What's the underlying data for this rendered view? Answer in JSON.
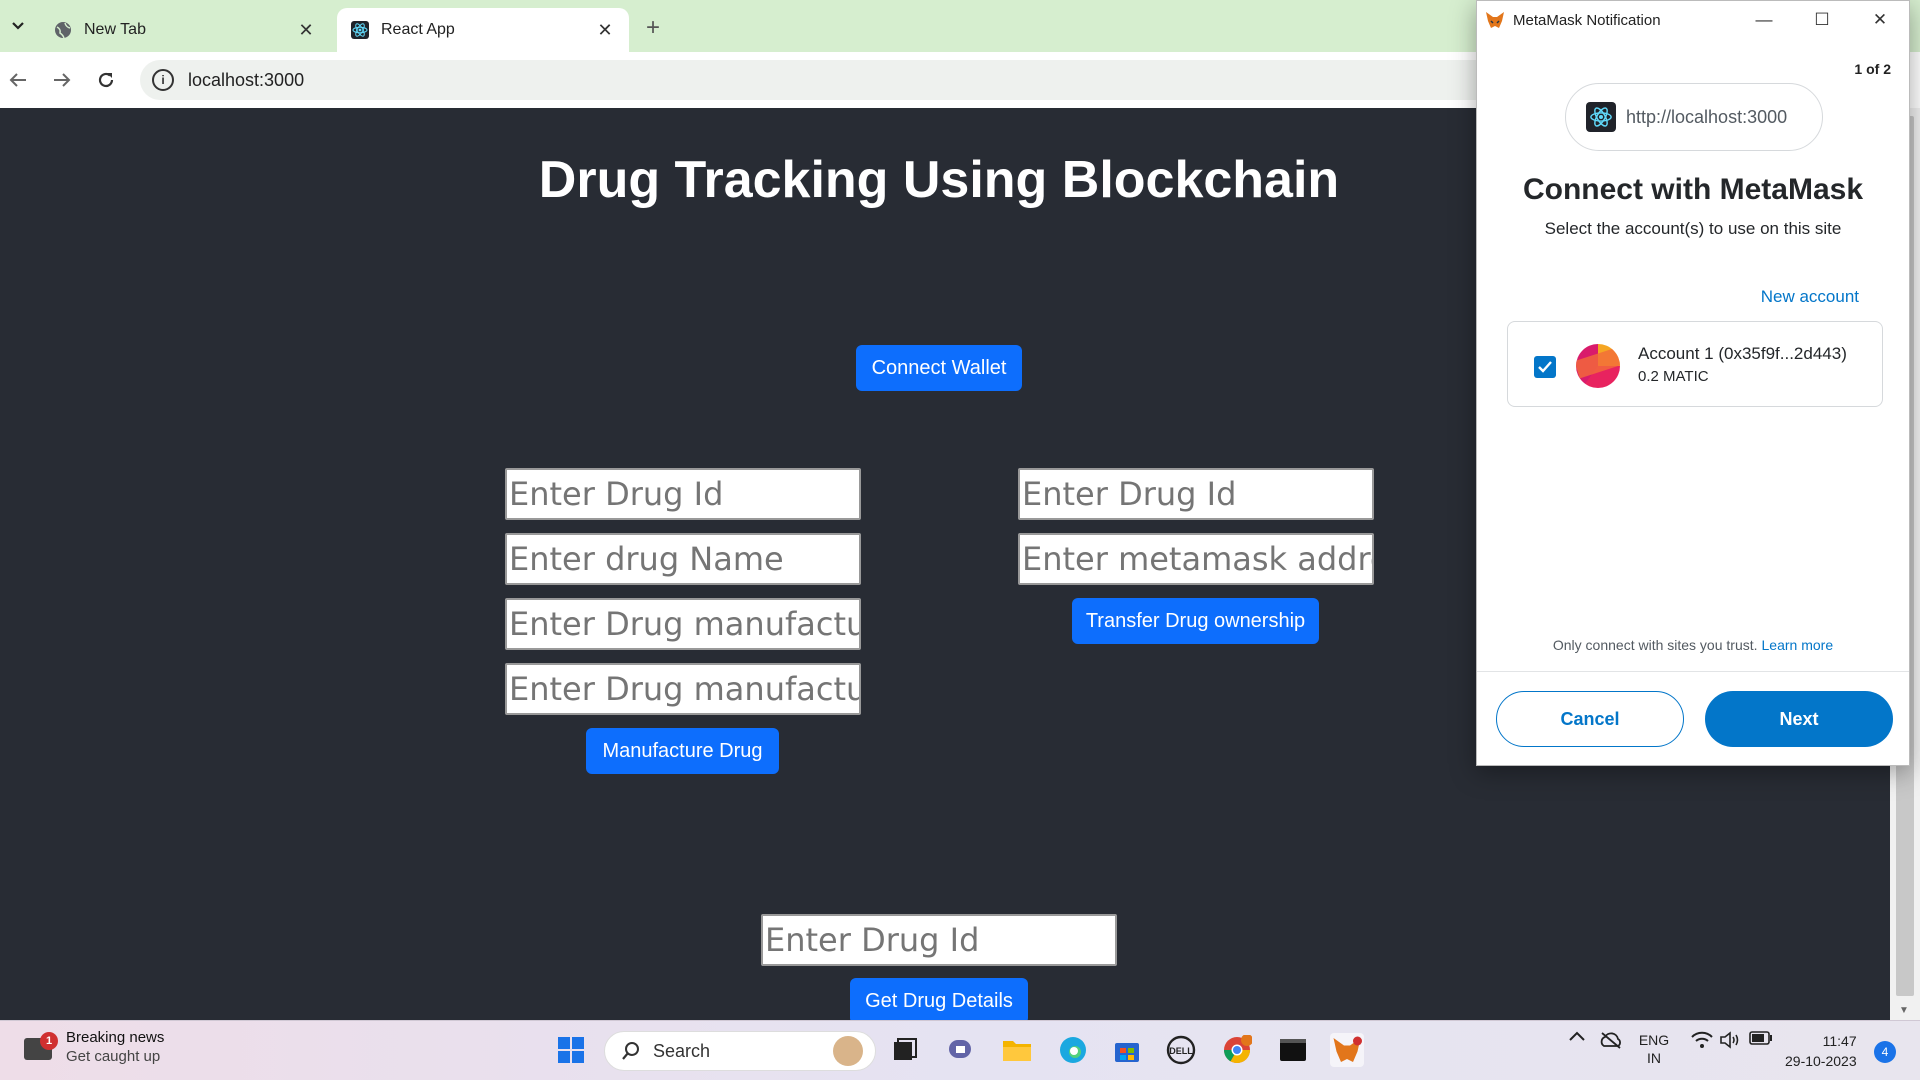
{
  "browser": {
    "tabs": [
      {
        "title": "New Tab",
        "close": "✕"
      },
      {
        "title": "React App",
        "close": "✕"
      }
    ],
    "new_tab": "+",
    "url": "localhost:3000"
  },
  "app": {
    "title": "Drug Tracking Using Blockchain",
    "connect_wallet": "Connect Wallet",
    "manufacture": {
      "fields": [
        "Enter Drug Id",
        "Enter drug Name",
        "Enter Drug manufacturer",
        "Enter Drug manufacturir"
      ],
      "button": "Manufacture Drug"
    },
    "transfer": {
      "fields": [
        "Enter Drug Id",
        "Enter metamask address"
      ],
      "button": "Transfer Drug ownership"
    },
    "details": {
      "field": "Enter Drug Id",
      "button": "Get Drug Details"
    }
  },
  "metamask": {
    "window_title": "MetaMask Notification",
    "pager": "1 of 2",
    "origin": "http://localhost:3000",
    "heading": "Connect with MetaMask",
    "subheading": "Select the account(s) to use on this site",
    "new_account": "New account",
    "account": {
      "name": "Account 1 (0x35f9f...2d443)",
      "balance": "0.2 MATIC",
      "checked": true
    },
    "trust_text": "Only connect with sites you trust.",
    "learn_more": "Learn more",
    "cancel": "Cancel",
    "next": "Next"
  },
  "taskbar": {
    "news_title": "Breaking news",
    "news_sub": "Get caught up",
    "news_badge": "1",
    "search": "Search",
    "lang1": "ENG",
    "lang2": "IN",
    "time": "11:47",
    "date": "29-10-2023",
    "notif_count": "4"
  },
  "colors": {
    "page_bg": "#282c34",
    "button_blue": "#0d6efd",
    "metamask_blue": "#0376c9",
    "tabbar_bg": "#d6eecf"
  }
}
